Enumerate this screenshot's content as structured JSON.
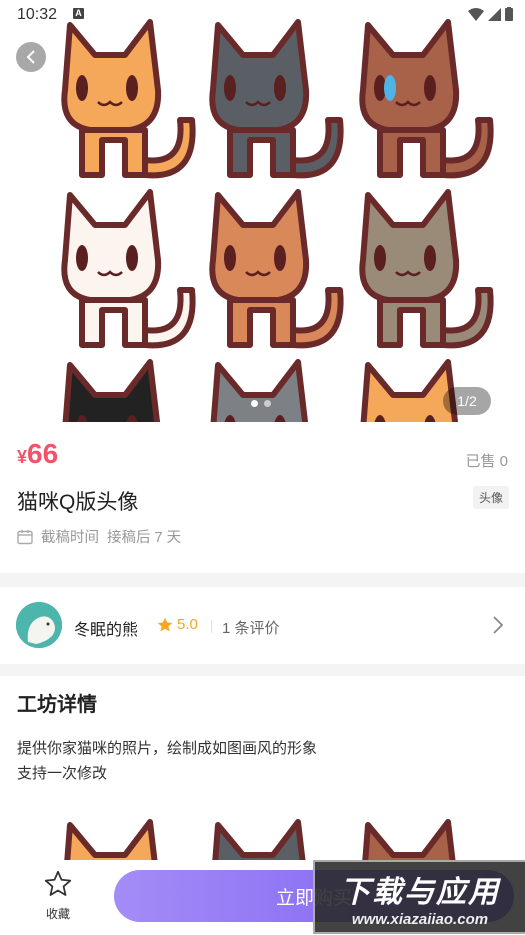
{
  "status_bar": {
    "time": "10:32"
  },
  "gallery": {
    "page_indicator": "1/2",
    "current": 1,
    "total": 2
  },
  "product": {
    "currency": "¥",
    "price": "66",
    "sold": "已售 0",
    "title": "猫咪Q版头像",
    "tag": "头像",
    "deadline_label": "截稿时间",
    "deadline_value": "接稿后 7 天"
  },
  "seller": {
    "name": "冬眠的熊",
    "rating": "5.0",
    "reviews": "1 条评价"
  },
  "details": {
    "title": "工坊详情",
    "lines": [
      "提供你家猫咪的照片，绘制成如图画风的形象",
      "支持一次修改"
    ]
  },
  "bottom_bar": {
    "favorite_label": "收藏",
    "buy_label": "立即购买"
  },
  "watermark": {
    "main": "下载与应用",
    "sub": "www.xiazaiiao.com"
  },
  "colors": {
    "price": "#f2526a",
    "accent": "#7a5cf0",
    "rating": "#f5a623"
  }
}
